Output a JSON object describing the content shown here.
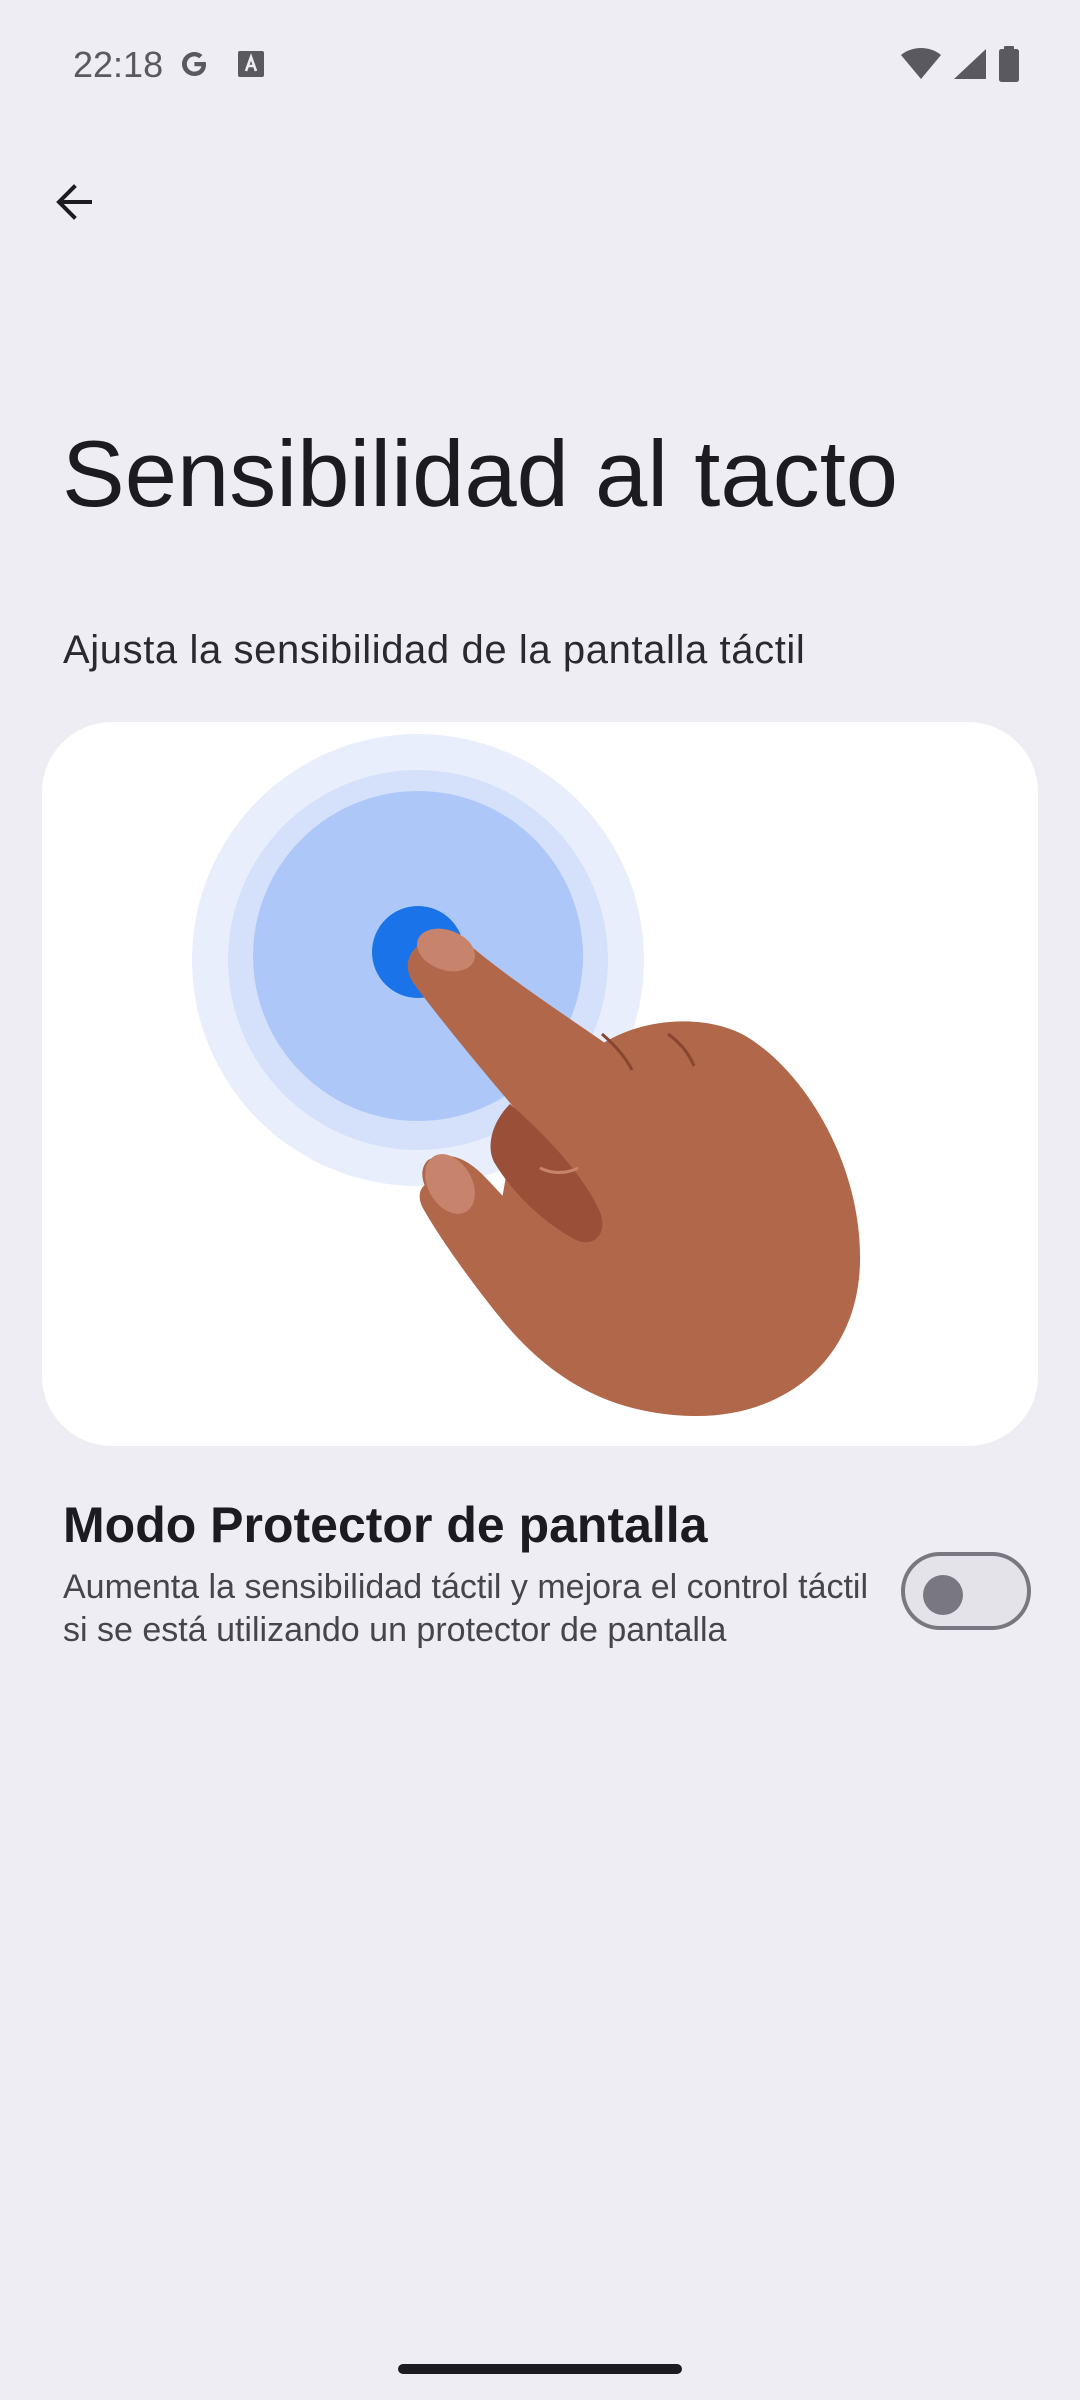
{
  "status_bar": {
    "time": "22:18",
    "left_icons": [
      "google-g-icon",
      "keyboard-a-icon"
    ],
    "right_icons": [
      "wifi-icon",
      "cellular-signal-icon",
      "battery-icon"
    ]
  },
  "header": {
    "back_icon": "arrow-back-icon"
  },
  "page": {
    "title": "Sensibilidad al tacto",
    "subtitle": "Ajusta la sensibilidad de la pantalla táctil"
  },
  "illustration": {
    "icon": "finger-touch-illustration",
    "colors": {
      "ring_outer": "#e8eefc",
      "ring_middle": "#d5e1fb",
      "ring_inner": "#adc8f8",
      "touch_dot": "#1a73e8",
      "skin": "#b0674a",
      "skin_shadow": "#9a5038",
      "nail": "#c8836c"
    }
  },
  "settings": {
    "screen_protector": {
      "title": "Modo Protector de pantalla",
      "description": "Aumenta la sensibilidad táctil y mejora el control táctil si se está utilizando un protector de pantalla",
      "enabled": false
    }
  },
  "colors": {
    "background": "#eeedf3",
    "text_primary": "#1c1b20",
    "text_secondary": "#46454d",
    "toggle_off": "#797880"
  }
}
